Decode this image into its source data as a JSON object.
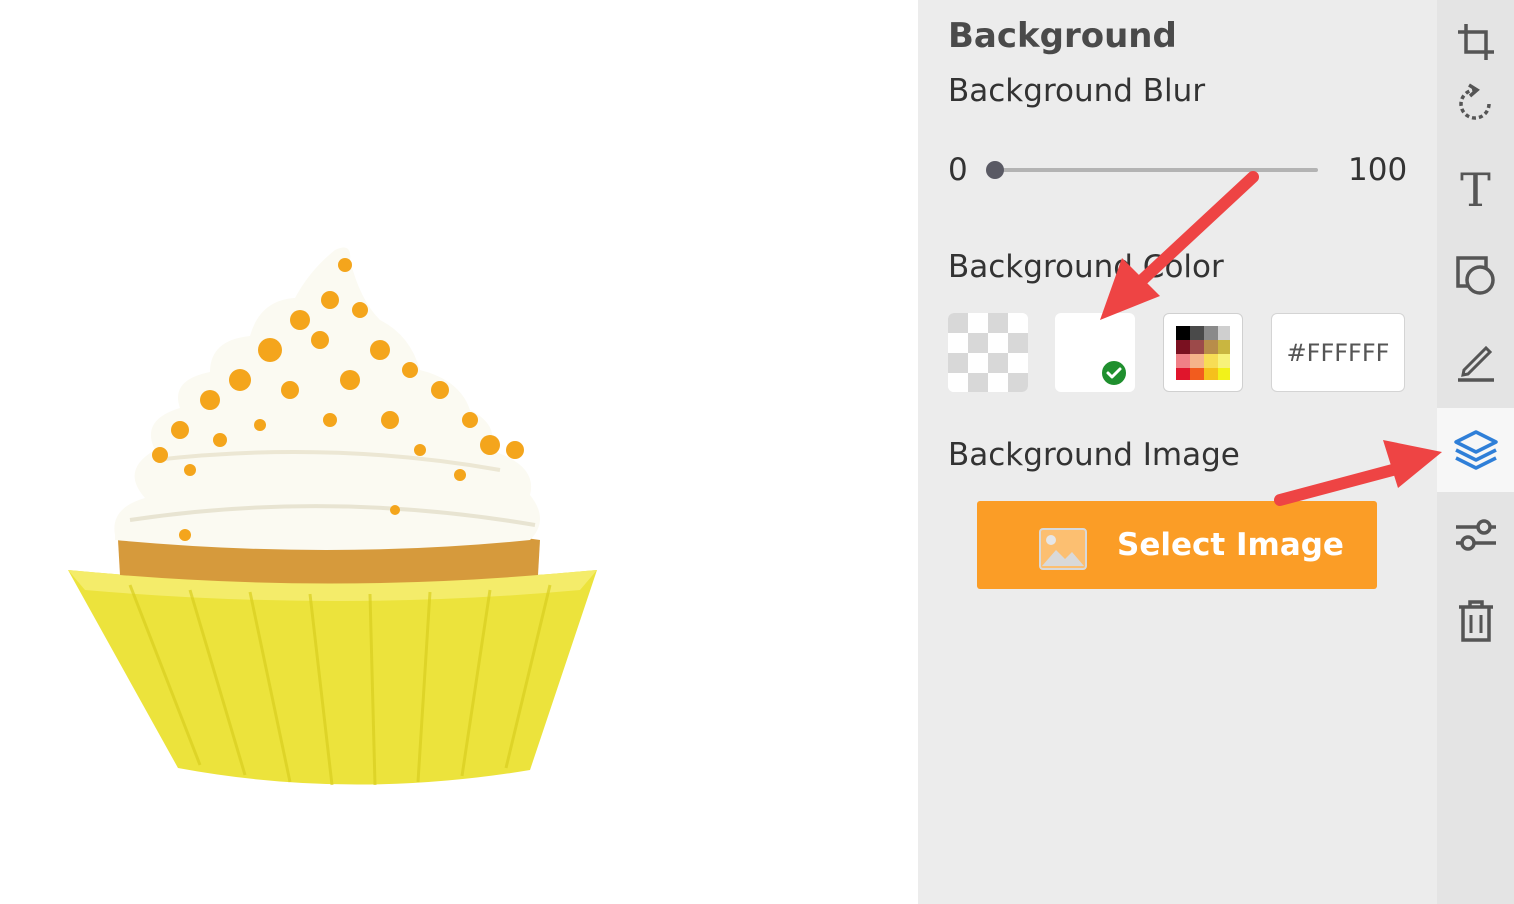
{
  "panel": {
    "title": "Background",
    "blur": {
      "label": "Background Blur",
      "min_label": "0",
      "max_label": "100",
      "value": 0
    },
    "color": {
      "label": "Background Color",
      "hex_value": "#FFFFFF",
      "swatches": [
        {
          "name": "transparent",
          "selected": false
        },
        {
          "name": "white",
          "color": "#FFFFFF",
          "selected": true
        },
        {
          "name": "palette",
          "selected": false
        }
      ]
    },
    "image": {
      "label": "Background Image",
      "select_button_label": "Select Image"
    }
  },
  "toolbar": {
    "tools": [
      "crop-icon",
      "rotate-icon",
      "text-icon",
      "shape-icon",
      "draw-icon",
      "layers-icon",
      "adjust-icon",
      "delete-icon"
    ],
    "text_tool_glyph": "T",
    "active_tool": "layers-icon"
  },
  "colors": {
    "accent": "#FB9D26",
    "panel_bg": "#ECECEC",
    "toolbar_bg": "#E4E4E4",
    "active_tool": "#2F7FD8",
    "selected_check": "#1F8F2E",
    "annotation_arrow": "#EE4444"
  }
}
